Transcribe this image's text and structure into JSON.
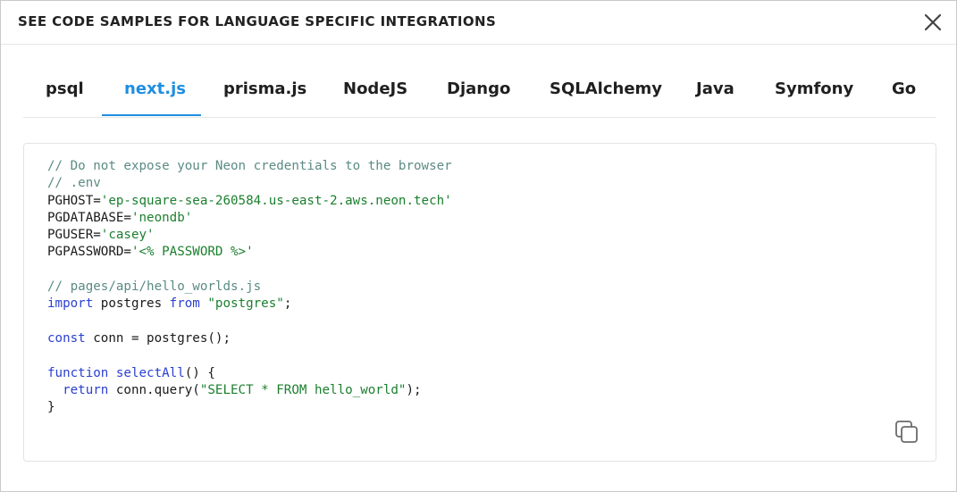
{
  "modal": {
    "title": "SEE CODE SAMPLES FOR LANGUAGE SPECIFIC INTEGRATIONS",
    "close_icon": "close-icon"
  },
  "tabs": [
    {
      "label": "psql",
      "active": false
    },
    {
      "label": "next.js",
      "active": true
    },
    {
      "label": "prisma.js",
      "active": false
    },
    {
      "label": "NodeJS",
      "active": false
    },
    {
      "label": "Django",
      "active": false
    },
    {
      "label": "SQLAlchemy",
      "active": false
    },
    {
      "label": "Java",
      "active": false
    },
    {
      "label": "Symfony",
      "active": false
    },
    {
      "label": "Go",
      "active": false
    }
  ],
  "code": {
    "comment_1": "// Do not expose your Neon credentials to the browser",
    "comment_2": "// .env",
    "pghost_key": "PGHOST=",
    "pghost_val": "'ep-square-sea-260584.us-east-2.aws.neon.tech'",
    "pgdatabase_key": "PGDATABASE=",
    "pgdatabase_val": "'neondb'",
    "pguser_key": "PGUSER=",
    "pguser_val": "'casey'",
    "pgpassword_key": "PGPASSWORD=",
    "pgpassword_val": "'<% PASSWORD %>'",
    "comment_3": "// pages/api/hello_worlds.js",
    "import_kw": "import",
    "import_name": " postgres ",
    "from_kw": "from",
    "import_src": "\"postgres\"",
    "import_end": ";",
    "const_kw": "const",
    "const_rest": " conn = postgres();",
    "function_kw": "function",
    "function_name": "selectAll",
    "function_rest": "() {",
    "return_kw": "return",
    "return_call": " conn.query(",
    "query_str": "\"SELECT * FROM hello_world\"",
    "return_end": ");",
    "closing_brace": "}"
  },
  "copy_icon": "copy-icon",
  "colors": {
    "accent": "#1f8ee0",
    "comment": "#5b8b84",
    "string": "#1b7f2e",
    "keyword": "#2a3fd0"
  }
}
